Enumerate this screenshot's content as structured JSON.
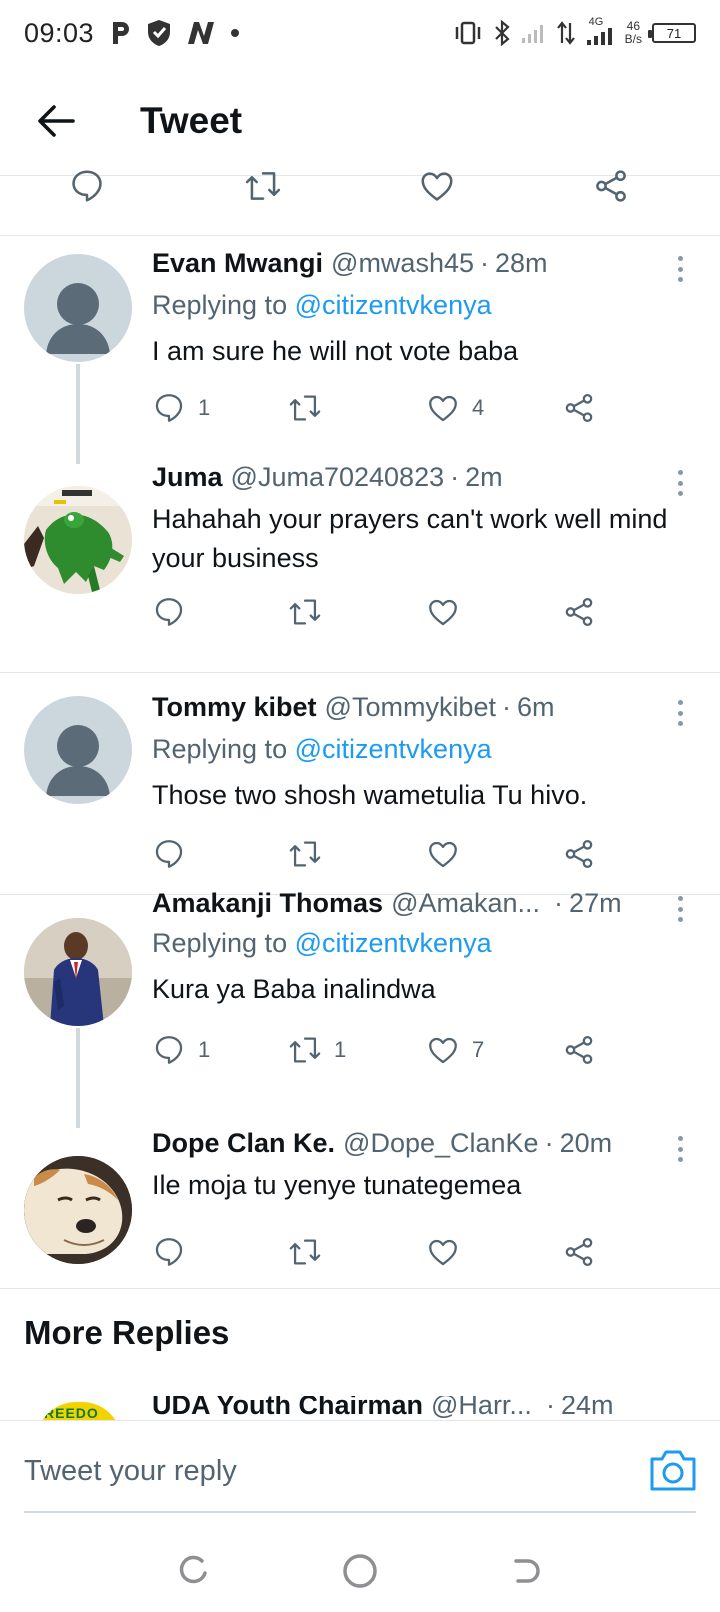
{
  "status_bar": {
    "time": "09:03",
    "net_speed_value": "46",
    "net_speed_unit": "B/s",
    "network_type": "4G",
    "battery_level": "71"
  },
  "header": {
    "title": "Tweet"
  },
  "tweets": [
    {
      "display_name": "Evan Mwangi",
      "handle": "@mwash45",
      "time_ago": "28m",
      "replying_label": "Replying to",
      "replying_to": "@citizentvkenya",
      "text": "I am sure he will not vote baba",
      "reply_count": "1",
      "retweet_count": "",
      "like_count": "4"
    },
    {
      "display_name": "Juma",
      "handle": "@Juma70240823",
      "time_ago": "2m",
      "text": "Hahahah your prayers can't work well mind your business",
      "reply_count": "",
      "retweet_count": "",
      "like_count": ""
    },
    {
      "display_name": "Tommy kibet",
      "handle": "@Tommykibet",
      "time_ago": "6m",
      "replying_label": "Replying to",
      "replying_to": "@citizentvkenya",
      "text": "Those two shosh wametulia Tu hivo.",
      "reply_count": "",
      "retweet_count": "",
      "like_count": ""
    },
    {
      "display_name": "Amakanji Thomas",
      "handle": "@Amakan...",
      "time_ago": "27m",
      "replying_label": "Replying to",
      "replying_to": "@citizentvkenya",
      "text": "Kura ya Baba inalindwa",
      "reply_count": "1",
      "retweet_count": "1",
      "like_count": "7"
    },
    {
      "display_name": "Dope Clan Ke.",
      "handle": "@Dope_ClanKe",
      "time_ago": "20m",
      "text": "Ile moja tu yenye tunategemea",
      "reply_count": "",
      "retweet_count": "",
      "like_count": ""
    }
  ],
  "more_replies": {
    "title": "More Replies",
    "peek_name": "UDA Youth Chairman",
    "peek_handle": "@Harr...",
    "peek_time": "24m"
  },
  "reply_bar": {
    "placeholder": "Tweet your reply"
  },
  "colors": {
    "accent": "#1d9bf0",
    "text_primary": "#0f1419",
    "text_secondary": "#536471",
    "divider": "#e5e8eb"
  }
}
